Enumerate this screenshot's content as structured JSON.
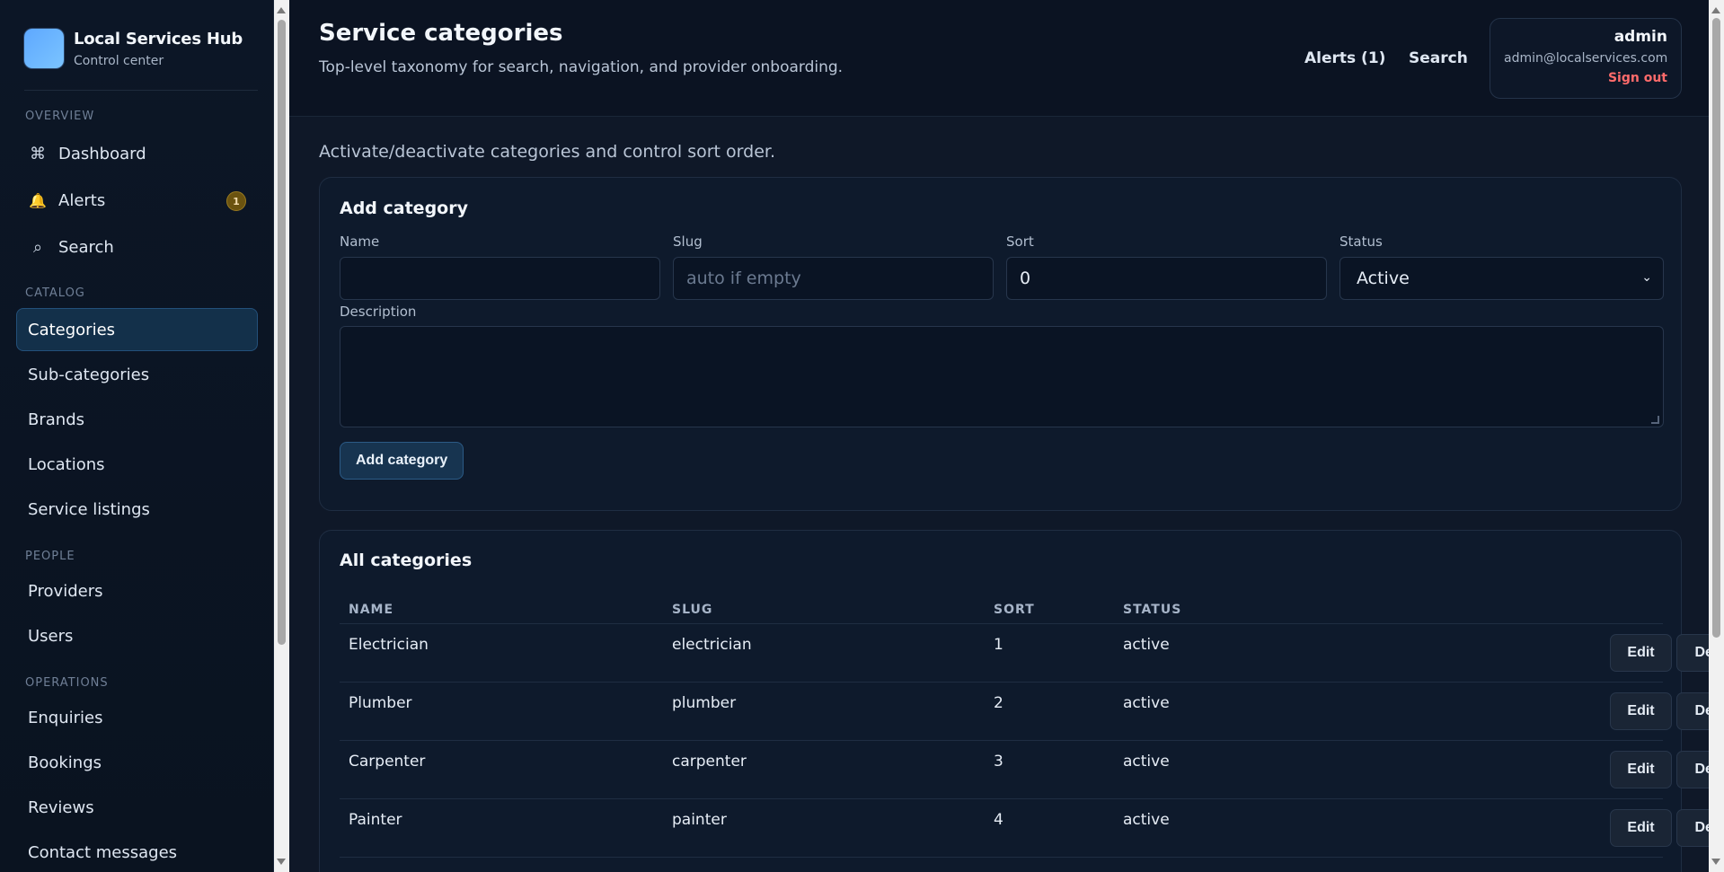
{
  "brand": {
    "title": "Local Services Hub",
    "subtitle": "Control center"
  },
  "sidebar": {
    "sections": {
      "overview": "OVERVIEW",
      "catalog": "CATALOG",
      "people": "PEOPLE",
      "operations": "OPERATIONS"
    },
    "items": {
      "dashboard": {
        "label": "Dashboard",
        "icon": "⌘"
      },
      "alerts": {
        "label": "Alerts",
        "icon": "🔔",
        "badge": "1"
      },
      "search": {
        "label": "Search",
        "icon": "⌕"
      },
      "categories": {
        "label": "Categories"
      },
      "subcategories": {
        "label": "Sub-categories"
      },
      "brands": {
        "label": "Brands"
      },
      "locations": {
        "label": "Locations"
      },
      "service_listings": {
        "label": "Service listings"
      },
      "providers": {
        "label": "Providers"
      },
      "users": {
        "label": "Users"
      },
      "enquiries": {
        "label": "Enquiries"
      },
      "bookings": {
        "label": "Bookings"
      },
      "reviews": {
        "label": "Reviews"
      },
      "contact_messages": {
        "label": "Contact messages"
      }
    }
  },
  "header": {
    "title": "Service categories",
    "subtitle": "Top-level taxonomy for search, navigation, and provider onboarding.",
    "alerts_link": "Alerts (1)",
    "search_link": "Search",
    "user": {
      "name": "admin",
      "email": "admin@localservices.com",
      "signout": "Sign out"
    }
  },
  "intro": "Activate/deactivate categories and control sort order.",
  "add_form": {
    "title": "Add category",
    "name_label": "Name",
    "name_value": "",
    "slug_label": "Slug",
    "slug_placeholder": "auto if empty",
    "sort_label": "Sort",
    "sort_value": "0",
    "status_label": "Status",
    "status_value": "Active",
    "description_label": "Description",
    "description_value": "",
    "submit_label": "Add category"
  },
  "table": {
    "title": "All categories",
    "columns": {
      "name": "NAME",
      "slug": "SLUG",
      "sort": "SORT",
      "status": "STATUS"
    },
    "edit_label": "Edit",
    "delete_label": "Delete",
    "rows": [
      {
        "name": "Electrician",
        "slug": "electrician",
        "sort": "1",
        "status": "active"
      },
      {
        "name": "Plumber",
        "slug": "plumber",
        "sort": "2",
        "status": "active"
      },
      {
        "name": "Carpenter",
        "slug": "carpenter",
        "sort": "3",
        "status": "active"
      },
      {
        "name": "Painter",
        "slug": "painter",
        "sort": "4",
        "status": "active"
      }
    ]
  },
  "colors": {
    "background": "#0f1828",
    "sidebar": "#0c1626",
    "accent": "#5ea8ff",
    "active_nav": "#13304a",
    "danger": "#ff6b6b",
    "badge": "#6b5310"
  }
}
